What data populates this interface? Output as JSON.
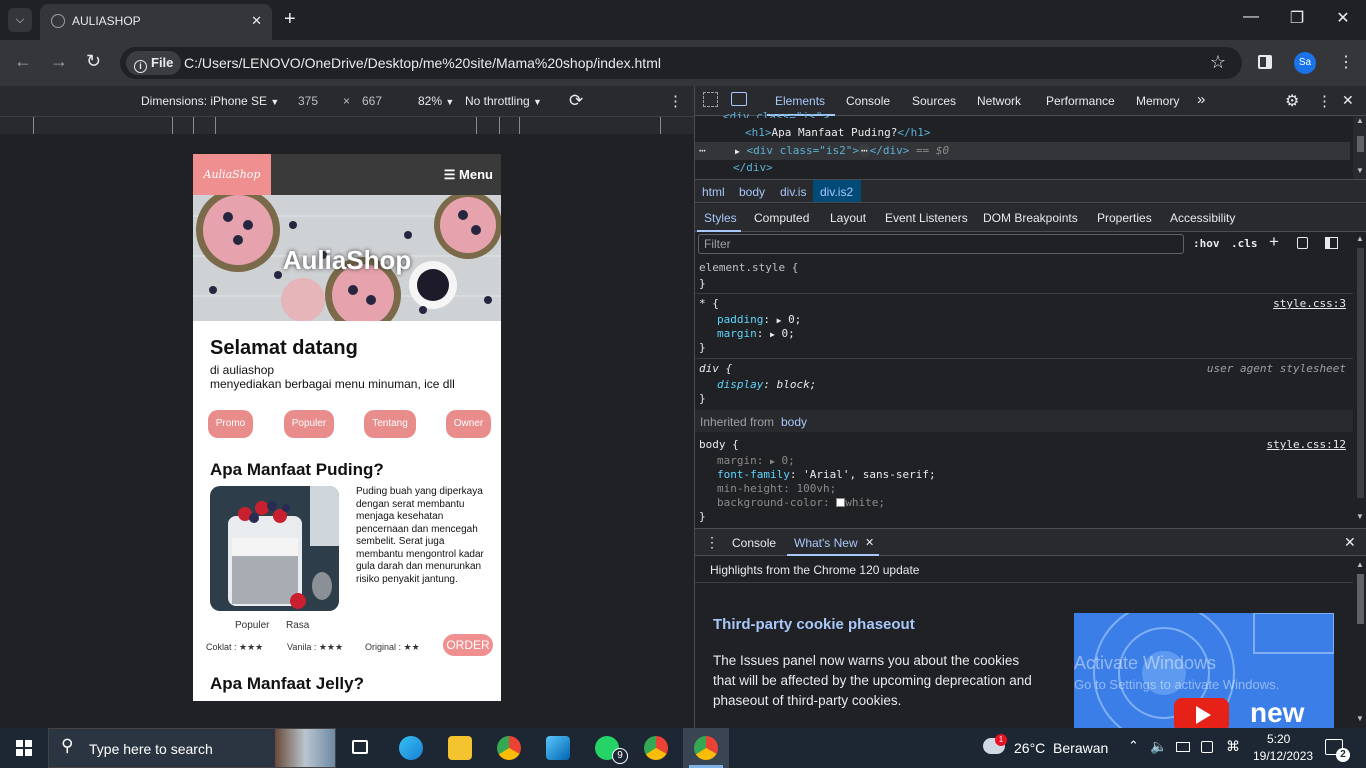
{
  "browser": {
    "tab_title": "AULIASHOP",
    "tab_close": "✕",
    "new_tab": "+",
    "url_chip": "File",
    "url": "C:/Users/LENOVO/OneDrive/Desktop/me%20site/Mama%20shop/index.html",
    "profile": "Sa"
  },
  "device_toolbar": {
    "dimensions_label": "Dimensions: iPhone SE",
    "width": "375",
    "times": "×",
    "height": "667",
    "zoom": "82%",
    "throttling": "No throttling"
  },
  "site": {
    "logo": "AuliaShop",
    "menu": "☰ Menu",
    "hero_title": "AuliaShop",
    "welcome_title": "Selamat datang",
    "welcome_line1": "di auliashop",
    "welcome_line2": "menyediakan berbagai menu minuman, ice dll",
    "buttons": [
      "Promo",
      "Populer",
      "Tentang",
      "Owner"
    ],
    "section1_title": "Apa Manfaat Puding?",
    "section1_desc": "Puding buah yang diperkaya dengan serat membantu menjaga kesehatan pencernaan dan mencegah sembelit. Serat juga membantu mengontrol kadar gula darah dan menurunkan risiko penyakit jantung.",
    "label_populer": "Populer",
    "label_rasa": "Rasa",
    "rating_coklat": "Coklat : ★★★",
    "rating_vanila": "Vanila : ★★★",
    "rating_original": "Original : ★★",
    "order_button": "ORDER",
    "section2_title": "Apa Manfaat Jelly?"
  },
  "devtools": {
    "tabs": [
      "Elements",
      "Console",
      "Sources",
      "Network",
      "Performance",
      "Memory"
    ],
    "more": "»",
    "dom_line1": "<div class=\"is\">",
    "dom_line2_open": "<h1>",
    "dom_line2_text": "Apa Manfaat Puding?",
    "dom_line2_close": "</h1>",
    "dom_line3": "<div class=\"is2\">",
    "dom_line3_mid": "⋯",
    "dom_line3_end": "</div>",
    "dom_line3_eq": "== $0",
    "dom_line4": "</div>",
    "dom_ellipsis": "⋯",
    "breadcrumbs": [
      "html",
      "body",
      "div.is",
      "div.is2"
    ],
    "style_tabs": [
      "Styles",
      "Computed",
      "Layout",
      "Event Listeners",
      "DOM Breakpoints",
      "Properties",
      "Accessibility"
    ],
    "filter_placeholder": "Filter",
    "hov": ":hov",
    "cls": ".cls",
    "rules": {
      "element_style": "element.style {",
      "close": "}",
      "star_selector": "* {",
      "star_source": "style.css:3",
      "padding": "padding",
      "margin": "margin",
      "zero_val": "0;",
      "div_selector": "div {",
      "ua_source": "user agent stylesheet",
      "display": "display",
      "block": "block;",
      "inherited_label": "Inherited from",
      "inherited_from": "body",
      "body_selector": "body {",
      "body_source": "style.css:12",
      "font_family": "font-family",
      "font_val": "'Arial', sans-serif;",
      "min_height": "min-height",
      "min_height_val": "100vh;",
      "bg_color": "background-color",
      "bg_val": "white;"
    },
    "drawer_tabs": [
      "Console",
      "What's New"
    ],
    "drawer_close": "✕",
    "highlights": "Highlights from the Chrome 120 update",
    "whatsnew_title": "Third-party cookie phaseout",
    "whatsnew_body": "The Issues panel now warns you about the cookies that will be affected by the upcoming deprecation and phaseout of third-party cookies.",
    "activate_line1": "Activate Windows",
    "activate_line2": "Go to Settings to activate Windows.",
    "video_word": "new"
  },
  "taskbar": {
    "search_placeholder": "Type here to search",
    "weather": "26°C  Berawan",
    "time": "5:20",
    "date": "19/12/2023",
    "whatsapp_badge": "9",
    "notif_count": "2",
    "weather_badge": "1"
  }
}
